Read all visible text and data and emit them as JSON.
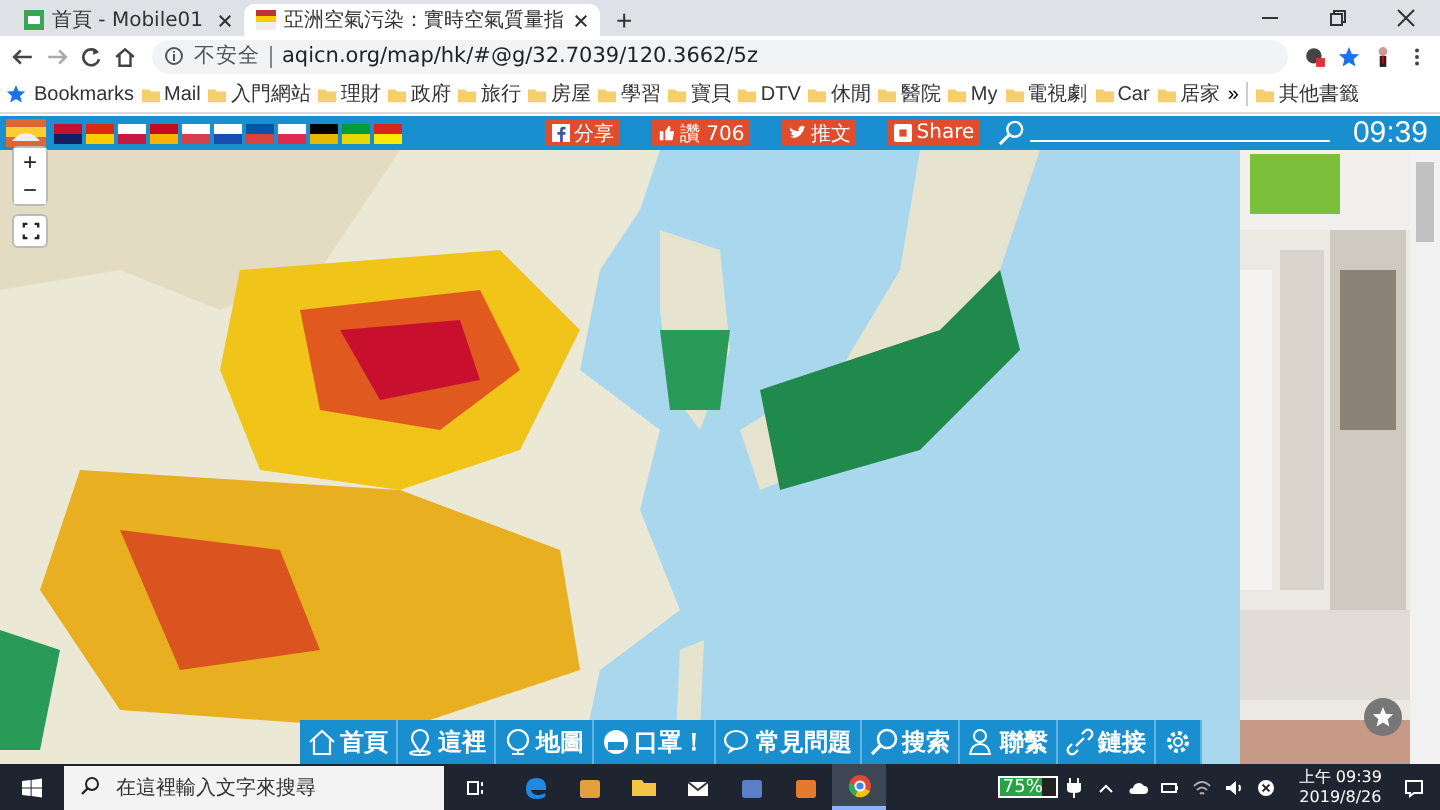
{
  "browser": {
    "tabs": [
      {
        "title": "首頁 - Mobile01",
        "selected": false
      },
      {
        "title": "亞洲空氣污染：實時空氣質量指",
        "selected": true
      }
    ],
    "new_tab": "+",
    "address": {
      "security": "不安全",
      "url": "aqicn.org/map/hk/#@g/32.7039/120.3662/5z"
    },
    "bookmarks_label": "Bookmarks",
    "bookmarks": [
      "Mail",
      "入門網站",
      "理財",
      "政府",
      "旅行",
      "房屋",
      "學習",
      "寶貝",
      "DTV",
      "休閒",
      "醫院",
      "My",
      "電視劇",
      "Car",
      "居家"
    ],
    "more_bookmarks": "»",
    "other_bookmarks": "其他書籤"
  },
  "site_toolbar": {
    "share_buttons": [
      {
        "kind": "facebook",
        "label": "分享"
      },
      {
        "kind": "like",
        "label": "讚 706"
      },
      {
        "kind": "twitter",
        "label": "推文"
      },
      {
        "kind": "share",
        "label": "Share"
      }
    ],
    "clock": "09:39"
  },
  "map": {
    "kind": "picture",
    "zoom_in": "+",
    "zoom_out": "−"
  },
  "bottom_nav": [
    {
      "kind": "home",
      "label": "首頁"
    },
    {
      "kind": "pin",
      "label": "這裡"
    },
    {
      "kind": "globe",
      "label": "地圖"
    },
    {
      "kind": "mask",
      "label": "口罩！"
    },
    {
      "kind": "chat",
      "label": "常見問題"
    },
    {
      "kind": "search",
      "label": "搜索"
    },
    {
      "kind": "contact",
      "label": "聯繫"
    },
    {
      "kind": "link",
      "label": "鏈接"
    },
    {
      "kind": "settings"
    }
  ],
  "taskbar": {
    "search_placeholder": "在這裡輸入文字來搜尋",
    "apps": [
      {
        "kind": "edge",
        "selected": false
      },
      {
        "kind": "paint",
        "selected": false
      },
      {
        "kind": "folder",
        "selected": false
      },
      {
        "kind": "mail",
        "selected": false
      },
      {
        "kind": "store",
        "selected": false
      },
      {
        "kind": "media",
        "selected": false
      },
      {
        "kind": "chrome",
        "selected": true
      }
    ],
    "battery": {
      "reading": "75%",
      "level": 0.75
    },
    "time": "上午 09:39",
    "date": "2019/8/26"
  }
}
